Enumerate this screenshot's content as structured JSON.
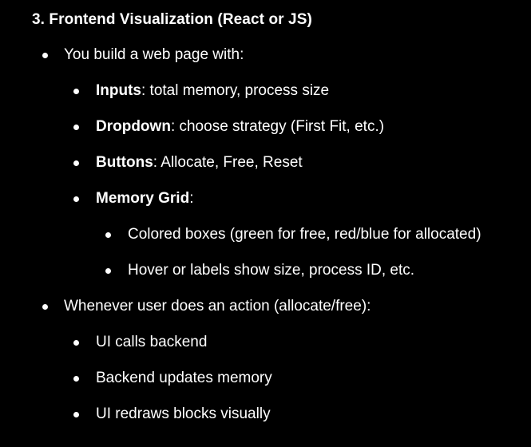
{
  "section": {
    "heading": "3. Frontend Visualization (React or JS)"
  },
  "items": [
    {
      "text": "You build a web page with:"
    },
    {
      "bold": "Inputs",
      "rest": ": total memory, process size"
    },
    {
      "bold": "Dropdown",
      "rest": ": choose strategy (First Fit, etc.)"
    },
    {
      "bold": "Buttons",
      "rest": ": Allocate, Free, Reset"
    },
    {
      "bold": "Memory Grid",
      "rest": ":"
    },
    {
      "text": "Colored boxes (green for free, red/blue for allocated)"
    },
    {
      "text": "Hover or labels show size, process ID, etc."
    },
    {
      "text": "Whenever user does an action (allocate/free):"
    },
    {
      "text": "UI calls backend"
    },
    {
      "text": "Backend updates memory"
    },
    {
      "text": "UI redraws blocks visually"
    }
  ]
}
